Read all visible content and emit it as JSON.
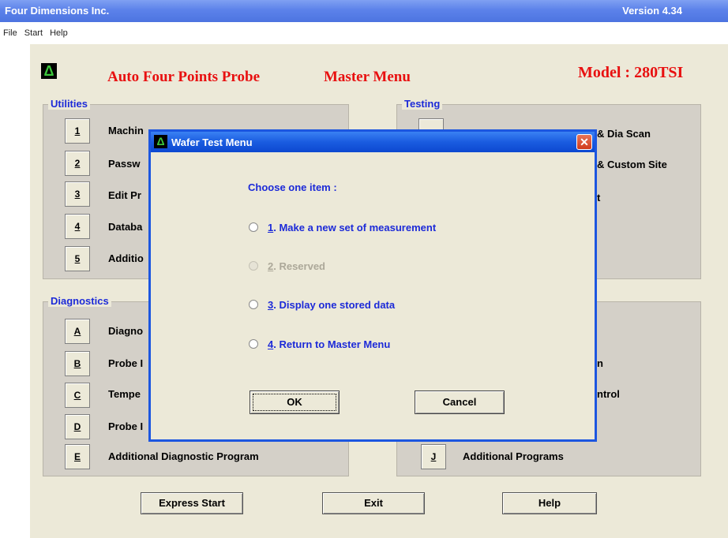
{
  "window": {
    "company": "Four Dimensions Inc.",
    "version": "Version 4.34"
  },
  "menu": [
    "File",
    "Start",
    "Help"
  ],
  "header": {
    "logo_glyph": "Δ",
    "app_name": "Auto Four Points Probe",
    "menu_title": "Master Menu",
    "model": "Model : 280TSI"
  },
  "utilities": {
    "title": "Utilities",
    "items": [
      {
        "key": "1",
        "label": "Machin"
      },
      {
        "key": "2",
        "label": "Passw"
      },
      {
        "key": "3",
        "label": "Edit Pr"
      },
      {
        "key": "4",
        "label": "Databa"
      },
      {
        "key": "5",
        "label": "Additio"
      }
    ]
  },
  "testing": {
    "title": "Testing",
    "items": [
      {
        "label": "& Dia Scan"
      },
      {
        "label": "& Custom Site"
      },
      {
        "label": "t"
      }
    ]
  },
  "diagnostics": {
    "title": "Diagnostics",
    "items": [
      {
        "key": "A",
        "label": "Diagno"
      },
      {
        "key": "B",
        "label": "Probe I"
      },
      {
        "key": "C",
        "label": "Tempe"
      },
      {
        "key": "D",
        "label": "Probe I"
      },
      {
        "key": "E",
        "label": "Additional Diagnostic Program"
      }
    ]
  },
  "programs": {
    "items": [
      {
        "label": "n"
      },
      {
        "label": "ntrol"
      },
      {
        "key": "J",
        "label": "Additional Programs"
      }
    ]
  },
  "bottom": {
    "express": "Express Start",
    "exit": "Exit",
    "help": "Help"
  },
  "dialog": {
    "title": "Wafer Test Menu",
    "close": "✕",
    "prompt": "Choose one item :",
    "options": [
      {
        "num": "1",
        "text": ". Make a new set of measurement"
      },
      {
        "num": "2",
        "text": ". Reserved"
      },
      {
        "num": "3",
        "text": ". Display one stored data"
      },
      {
        "num": "4",
        "text": ". Return to Master Menu"
      }
    ],
    "ok": "OK",
    "cancel": "Cancel"
  }
}
